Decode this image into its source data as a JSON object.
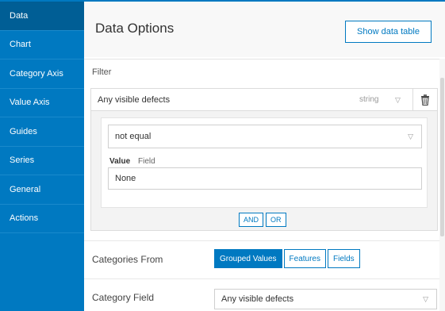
{
  "sidebar": {
    "items": [
      {
        "label": "Data"
      },
      {
        "label": "Chart"
      },
      {
        "label": "Category Axis"
      },
      {
        "label": "Value Axis"
      },
      {
        "label": "Guides"
      },
      {
        "label": "Series"
      },
      {
        "label": "General"
      },
      {
        "label": "Actions"
      }
    ],
    "active": "Data"
  },
  "header": {
    "title": "Data Options",
    "show_table_label": "Show data table"
  },
  "filter": {
    "label": "Filter",
    "field_name": "Any visible defects",
    "field_type": "string",
    "operator": "not equal",
    "tabs": {
      "value": "Value",
      "field": "Field"
    },
    "value": "None",
    "logic": {
      "and": "AND",
      "or": "OR"
    }
  },
  "categories_from": {
    "label": "Categories From",
    "options": [
      "Grouped Values",
      "Features",
      "Fields"
    ],
    "selected": "Grouped Values"
  },
  "category_field": {
    "label": "Category Field",
    "value": "Any visible defects"
  },
  "icons": {
    "chevron": "chevron-down-icon",
    "trash": "trash-icon"
  },
  "colors": {
    "accent": "#0079c1",
    "sidebar_active": "#005e95"
  }
}
